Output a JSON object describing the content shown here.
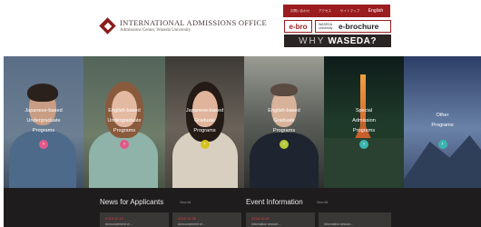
{
  "header": {
    "logo_title": "INTERNATIONAL ADMISSIONS OFFICE",
    "logo_subtitle": "Admissions Center, Waseda University",
    "topnav": [
      "お問い合わせ",
      "アクセス",
      "サイトマップ",
      "English"
    ],
    "ebro_label": "e-bro",
    "ebrochure_small": "WASEDA University",
    "ebrochure_label": "e-brochure",
    "why_label": "WHY",
    "waseda_label": "WASEDA?"
  },
  "hero": {
    "panels": [
      {
        "label_lines": [
          "Japanese-based",
          "Undergraduate",
          "Programs"
        ],
        "dot_color": "#e05a8a"
      },
      {
        "label_lines": [
          "English-based",
          "Undergraduate",
          "Programs"
        ],
        "dot_color": "#e05a8a"
      },
      {
        "label_lines": [
          "Japanese-based",
          "Graduate",
          "Programs"
        ],
        "dot_color": "#d8c21e"
      },
      {
        "label_lines": [
          "English-based",
          "Graduate",
          "Programs"
        ],
        "dot_color": "#b8c93a"
      },
      {
        "label_lines": [
          "Special",
          "Admission",
          "Programs"
        ],
        "dot_color": "#3ab4b0"
      },
      {
        "label_lines": [
          "Other",
          "Programs"
        ],
        "dot_color": "#3ab4b0"
      }
    ]
  },
  "news": {
    "applicants_title": "News for Applicants",
    "applicants_viewall": "View All",
    "event_title": "Event Information",
    "event_viewall": "View All",
    "cards": [
      {
        "date": "2018.10.10",
        "text": "Announcement of ..."
      },
      {
        "date": "2018.10.05",
        "text": "Announcement of ..."
      },
      {
        "date": "2018.10.01",
        "text": "Information session ..."
      },
      {
        "date": "",
        "text": "Information session ..."
      }
    ]
  },
  "colors": {
    "brand_red": "#9b1c1f",
    "hero_bg_dark": "#1e1c1c"
  }
}
